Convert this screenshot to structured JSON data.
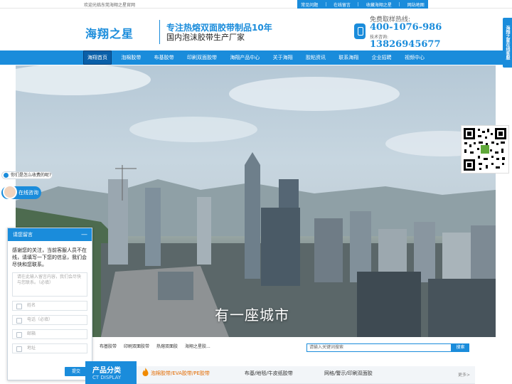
{
  "topbar": {
    "welcome": "欢迎光临东莞海翔之星官网",
    "links": [
      "常见问题",
      "在线留言",
      "收藏海翔之星",
      "网站地图"
    ]
  },
  "header": {
    "logo": "海翔之星",
    "slogan_main": "专注热熔双面胶带制品10年",
    "slogan_sub": "国内泡沫胶带生产厂家",
    "hotline_label": "免费取样热线:",
    "hotline": "400-1076-986",
    "tech_label": "技术咨询:",
    "mobile": "13826945677"
  },
  "nav": {
    "items": [
      "海翔首页",
      "泡棉胶带",
      "布基胶带",
      "印刷双面胶带",
      "海翔产品中心",
      "关于海翔",
      "胶粘资讯",
      "联系海翔",
      "企业招聘",
      "视频中心"
    ]
  },
  "side_tab": "海翔之星在线客服",
  "banner": {
    "caption": "有一座城市"
  },
  "chat": {
    "bubble": "你们是怎么收费的呢?",
    "online": "在线咨询"
  },
  "message_panel": {
    "title": "请您留言",
    "minimize": "—",
    "intro": "感谢您的关注，当前客服人员不在线，请填写一下您的信息，我们会尽快和您联系。",
    "textarea_placeholder": "请在此输入留言内容，我们会尽快与您联系。（必填）",
    "fields": [
      "姓名",
      "电话（必填）",
      "邮箱",
      "地址"
    ],
    "submit": "提交"
  },
  "hot_words": [
    "布基胶带",
    "印刷双面胶带",
    "热熔双面胶",
    "海翔之星胶..."
  ],
  "search": {
    "placeholder": "请输入关键词搜索",
    "button": "搜索"
  },
  "products": {
    "title_cn": "产品分类",
    "title_en": "CT DISPLAY",
    "tabs": [
      "泡棉胶带/EVA胶带/PE胶带",
      "布基/地毯/牛皮纸胶带",
      "网格/警示/印刷双面胶"
    ],
    "more": "更多>"
  },
  "colors": {
    "brand_blue": "#1a8cdb",
    "active_orange": "#e36b00"
  }
}
